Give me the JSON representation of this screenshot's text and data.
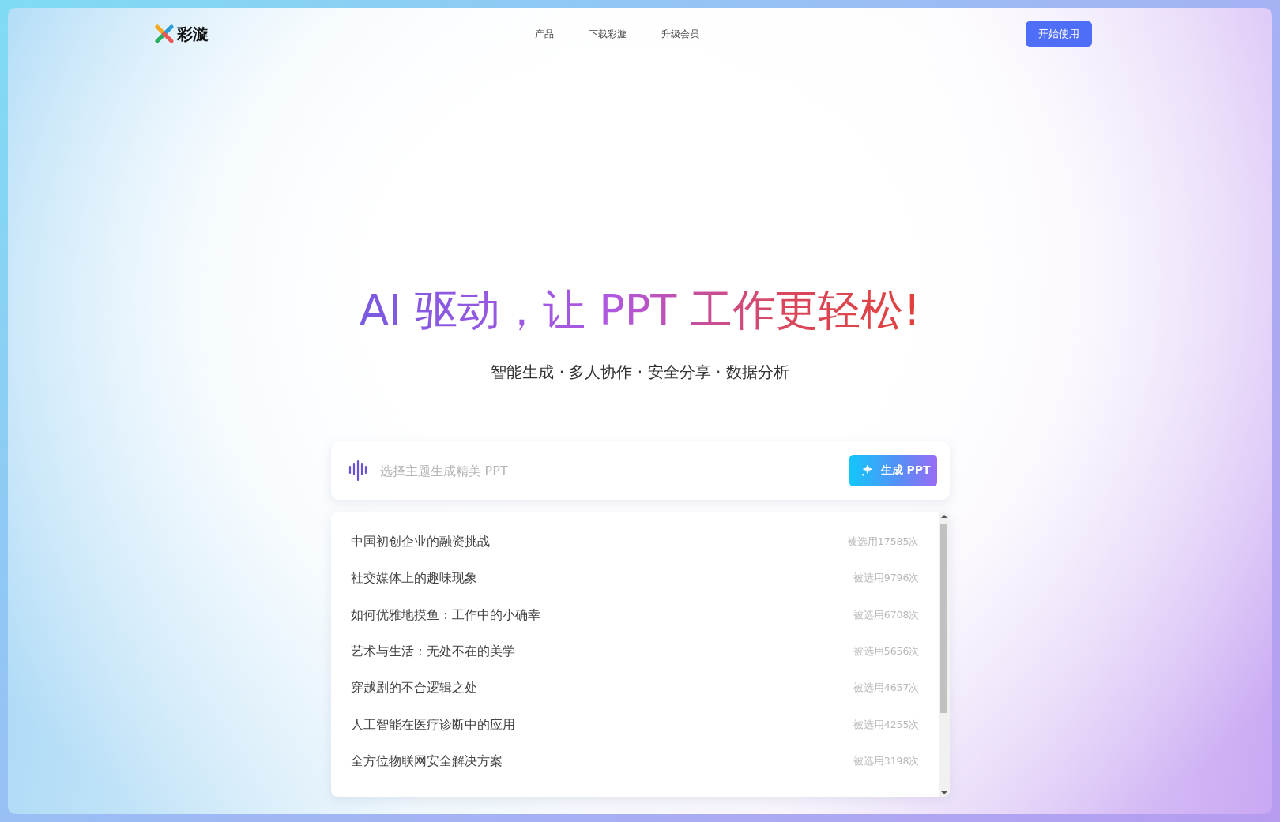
{
  "header": {
    "logo": "彩漩",
    "nav": [
      {
        "label": "产品"
      },
      {
        "label": "下载彩漩"
      },
      {
        "label": "升级会员"
      }
    ],
    "cta": "开始使用"
  },
  "hero": {
    "title": "AI 驱动，让 PPT 工作更轻松!",
    "subtitle": "智能生成 · 多人协作 · 安全分享 · 数据分析"
  },
  "prompt": {
    "placeholder": "选择主题生成精美 PPT",
    "button": "生成 PPT"
  },
  "topics": [
    {
      "title": "中国初创企业的融资挑战",
      "count": "被选用17585次"
    },
    {
      "title": "社交媒体上的趣味现象",
      "count": "被选用9796次"
    },
    {
      "title": "如何优雅地摸鱼：工作中的小确幸",
      "count": "被选用6708次"
    },
    {
      "title": "艺术与生活：无处不在的美学",
      "count": "被选用5656次"
    },
    {
      "title": "穿越剧的不合逻辑之处",
      "count": "被选用4657次"
    },
    {
      "title": "人工智能在医疗诊断中的应用",
      "count": "被选用4255次"
    },
    {
      "title": "全方位物联网安全解决方案",
      "count": "被选用3198次"
    }
  ]
}
